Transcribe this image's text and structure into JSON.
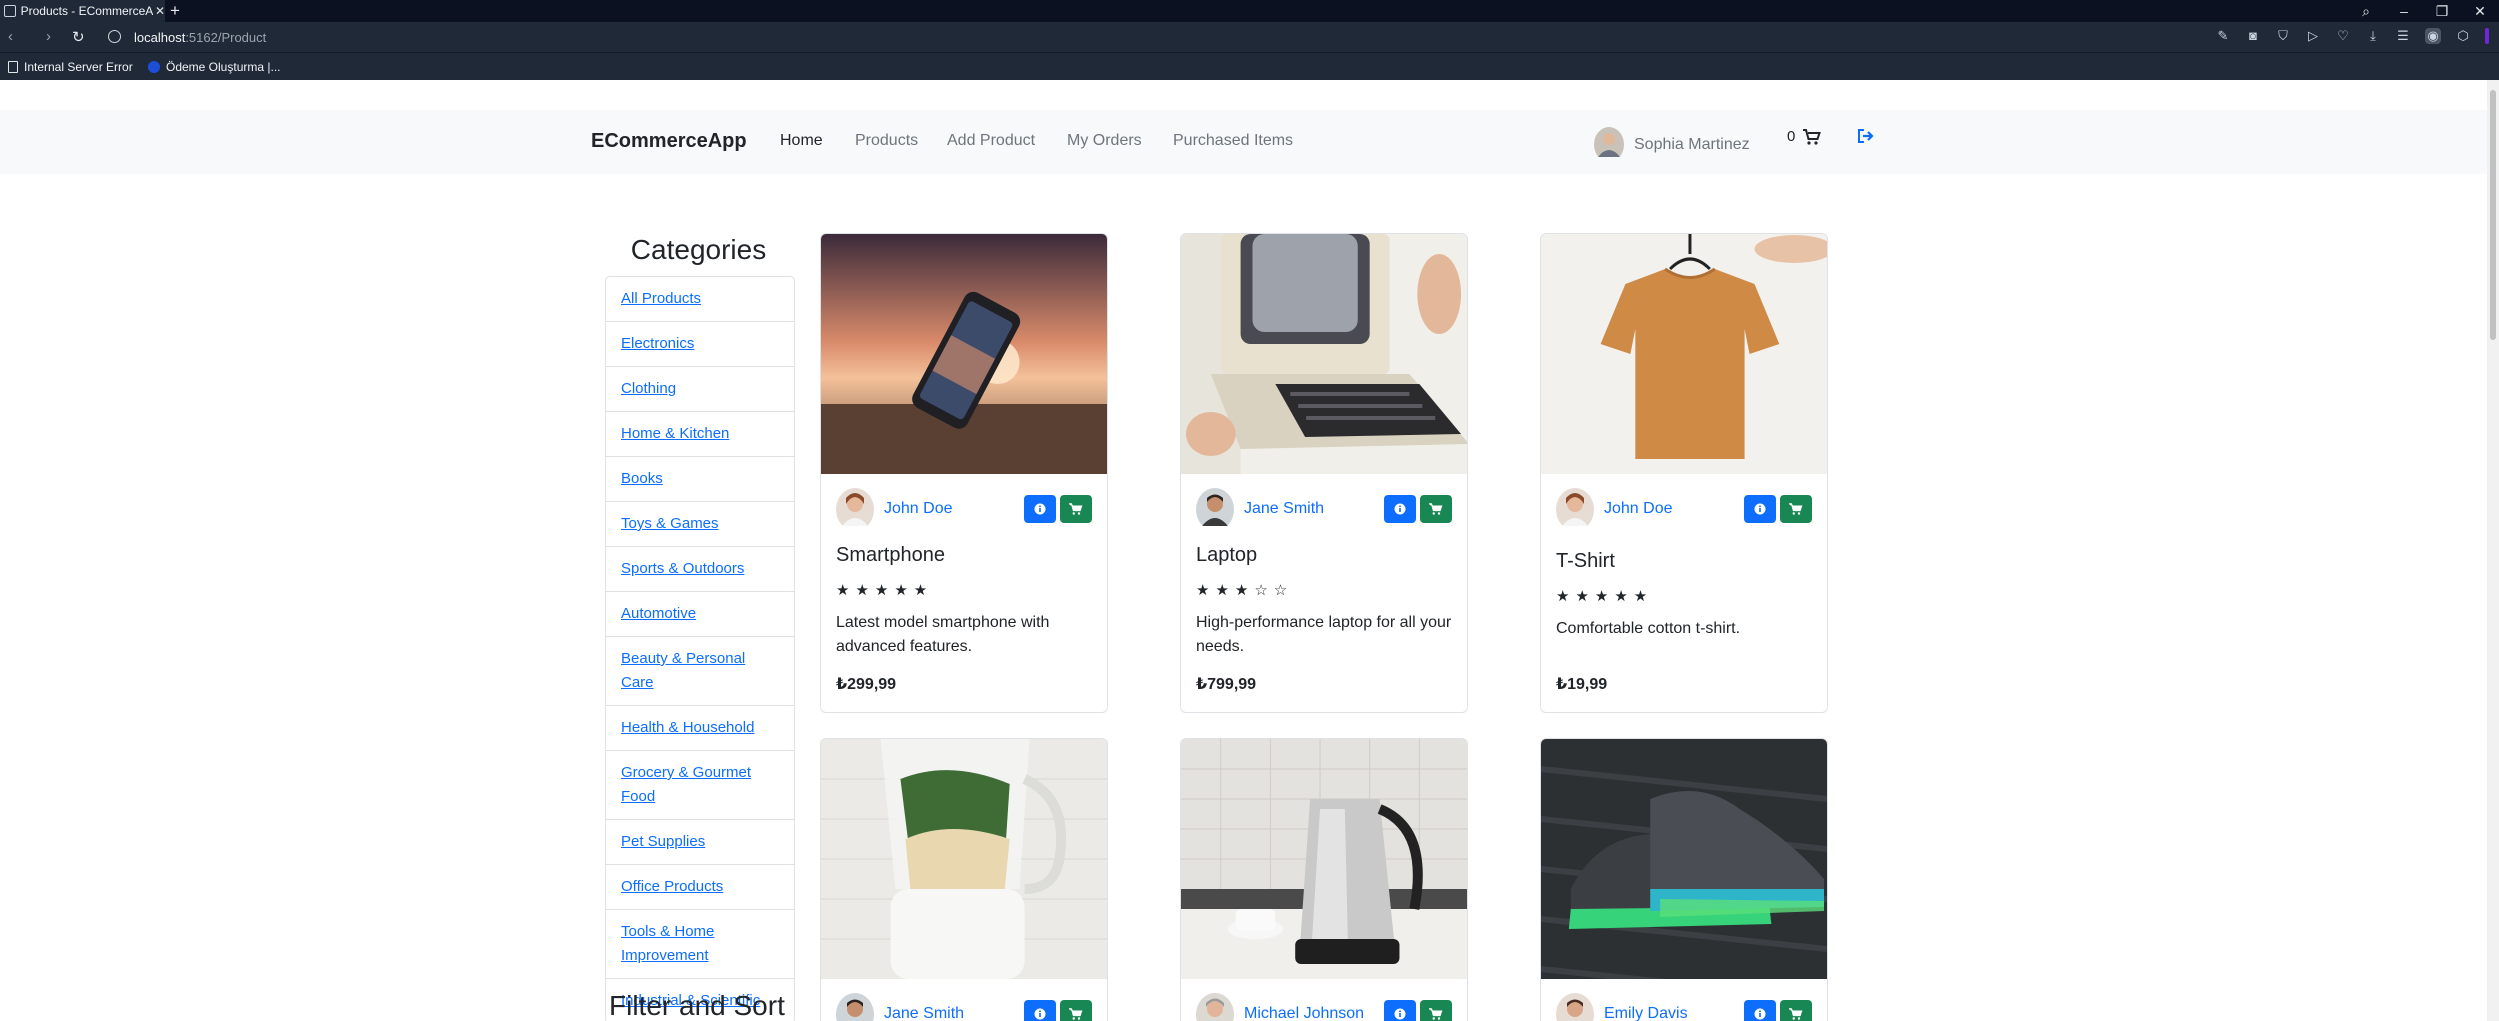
{
  "browser": {
    "tab_title": "Products - ECommerceAp",
    "url_host": "localhost",
    "url_path": ":5162/Product",
    "bookmarks": [
      "Internal Server Error",
      "Ödeme Oluşturma |..."
    ]
  },
  "navbar": {
    "brand": "ECommerceApp",
    "links": [
      "Home",
      "Products",
      "Add Product",
      "My Orders",
      "Purchased Items"
    ],
    "active_link": "Home",
    "user_name": "Sophia Martinez",
    "cart_count": "0"
  },
  "sidebar": {
    "title": "Categories",
    "categories": [
      "All Products",
      "Electronics",
      "Clothing",
      "Home & Kitchen",
      "Books",
      "Toys & Games",
      "Sports & Outdoors",
      "Automotive",
      "Beauty & Personal Care",
      "Health & Household",
      "Grocery & Gourmet Food",
      "Pet Supplies",
      "Office Products",
      "Tools & Home Improvement",
      "Industrial & Scientific"
    ],
    "filter_title": "Filter and Sort"
  },
  "products": [
    {
      "seller": "John Doe",
      "title": "Smartphone",
      "rating": 5,
      "stars": "★★★★★",
      "description": "Latest model smartphone with advanced features.",
      "price": "₺299,99"
    },
    {
      "seller": "Jane Smith",
      "title": "Laptop",
      "rating": 3,
      "stars": "★★★☆☆",
      "description": "High-performance laptop for all your needs.",
      "price": "₺799,99"
    },
    {
      "seller": "John Doe",
      "title": "T-Shirt",
      "rating": 5,
      "stars": "★★★★★",
      "description": "Comfortable cotton t-shirt.",
      "price": "₺19,99"
    },
    {
      "seller": "Jane Smith"
    },
    {
      "seller": "Michael Johnson"
    },
    {
      "seller": "Emily Davis"
    }
  ],
  "colors": {
    "primary": "#0d6efd",
    "success": "#198754",
    "navbar_bg": "#f8f9fa"
  }
}
